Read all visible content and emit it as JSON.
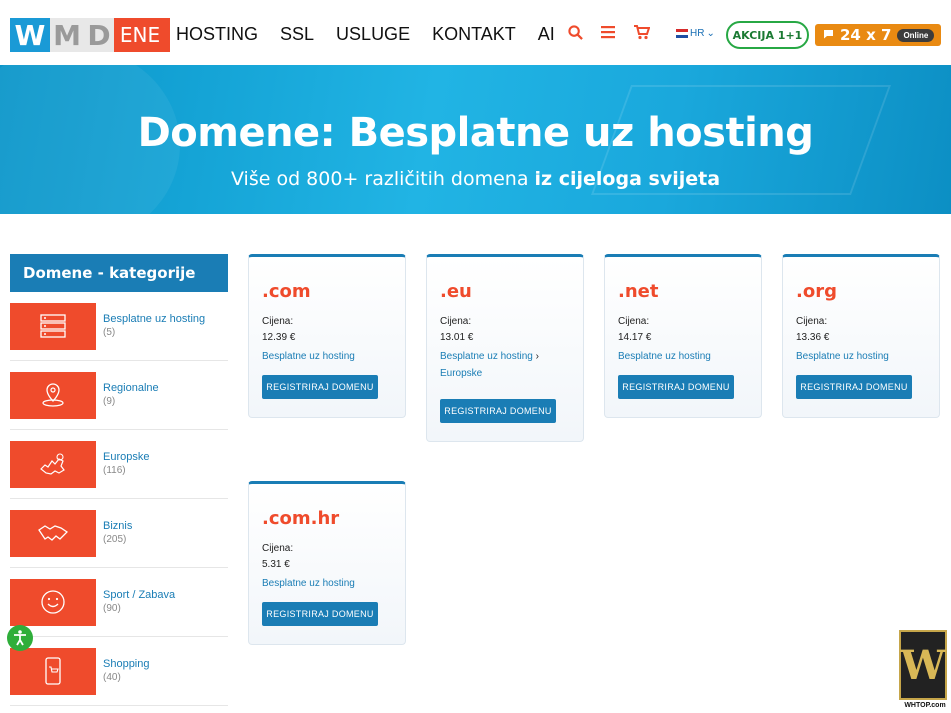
{
  "header": {
    "logo": {
      "w": "W",
      "m": "M",
      "d": "D",
      "ene": "ENE"
    },
    "nav": [
      "HOSTING",
      "SSL",
      "USLUGE",
      "KONTAKT",
      "AI"
    ],
    "language": "HR",
    "akcija": "AKCIJA 1+1",
    "chat_label": "24 x 7",
    "chat_status": "Online"
  },
  "hero": {
    "title": "Domene: Besplatne uz hosting",
    "subtitle_plain": "Više od 800+ različitih domena ",
    "subtitle_bold": "iz cijeloga svijeta"
  },
  "sidebar": {
    "title": "Domene - kategorije",
    "items": [
      {
        "label": "Besplatne uz hosting",
        "count": "(5)",
        "icon": "server-icon"
      },
      {
        "label": "Regionalne",
        "count": "(9)",
        "icon": "location-pin-icon"
      },
      {
        "label": "Europske",
        "count": "(116)",
        "icon": "europe-map-icon"
      },
      {
        "label": "Biznis",
        "count": "(205)",
        "icon": "handshake-icon"
      },
      {
        "label": "Sport / Zabava",
        "count": "(90)",
        "icon": "smiley-icon"
      },
      {
        "label": "Shopping",
        "count": "(40)",
        "icon": "mobile-cart-icon"
      }
    ]
  },
  "cards": [
    {
      "tld": ".com",
      "price_label": "Cijena:",
      "price": "12.39 €",
      "cat1": "Besplatne uz hosting",
      "cat2": "",
      "button": "REGISTRIRAJ DOMENU"
    },
    {
      "tld": ".eu",
      "price_label": "Cijena:",
      "price": "13.01 €",
      "cat1": "Besplatne uz hosting",
      "cat2": "Europske",
      "button": "REGISTRIRAJ DOMENU"
    },
    {
      "tld": ".net",
      "price_label": "Cijena:",
      "price": "14.17 €",
      "cat1": "Besplatne uz hosting",
      "cat2": "",
      "button": "REGISTRIRAJ DOMENU"
    },
    {
      "tld": ".org",
      "price_label": "Cijena:",
      "price": "13.36 €",
      "cat1": "Besplatne uz hosting",
      "cat2": "",
      "button": "REGISTRIRAJ DOMENU"
    },
    {
      "tld": ".com.hr",
      "price_label": "Cijena:",
      "price": "5.31 €",
      "cat1": "Besplatne uz hosting",
      "cat2": "",
      "button": "REGISTRIRAJ DOMENU"
    }
  ],
  "watermark": {
    "logo": "W",
    "text": "WHTOP.com"
  },
  "colors": {
    "accent": "#ef4b2c",
    "primary": "#1a7db5",
    "hero": "#21b4e4",
    "green": "#27a844",
    "chat": "#e98a12"
  }
}
